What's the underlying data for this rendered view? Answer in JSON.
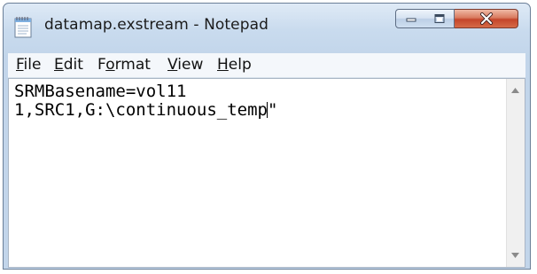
{
  "window": {
    "title": "datamap.exstream - Notepad"
  },
  "menu": {
    "items": [
      {
        "label": "File",
        "mnemonic": "F",
        "rest": "ile"
      },
      {
        "label": "Edit",
        "mnemonic": "E",
        "rest": "dit"
      },
      {
        "label": "Format",
        "pre": "F",
        "mnemonic": "o",
        "rest": "rmat"
      },
      {
        "label": "View",
        "mnemonic": "V",
        "rest": "iew"
      },
      {
        "label": "Help",
        "mnemonic": "H",
        "rest": "elp"
      }
    ]
  },
  "editor": {
    "line1": "SRMBasename=vol11",
    "line2_before_caret": "1,SRC1,G:\\continuous_temp",
    "line2_after_caret": "\""
  },
  "icons": {
    "app": "notepad-icon",
    "minimize": "minimize-icon",
    "maximize": "maximize-icon",
    "close": "close-icon",
    "scroll_up": "scroll-up-arrow-icon",
    "scroll_down": "scroll-down-arrow-icon"
  }
}
